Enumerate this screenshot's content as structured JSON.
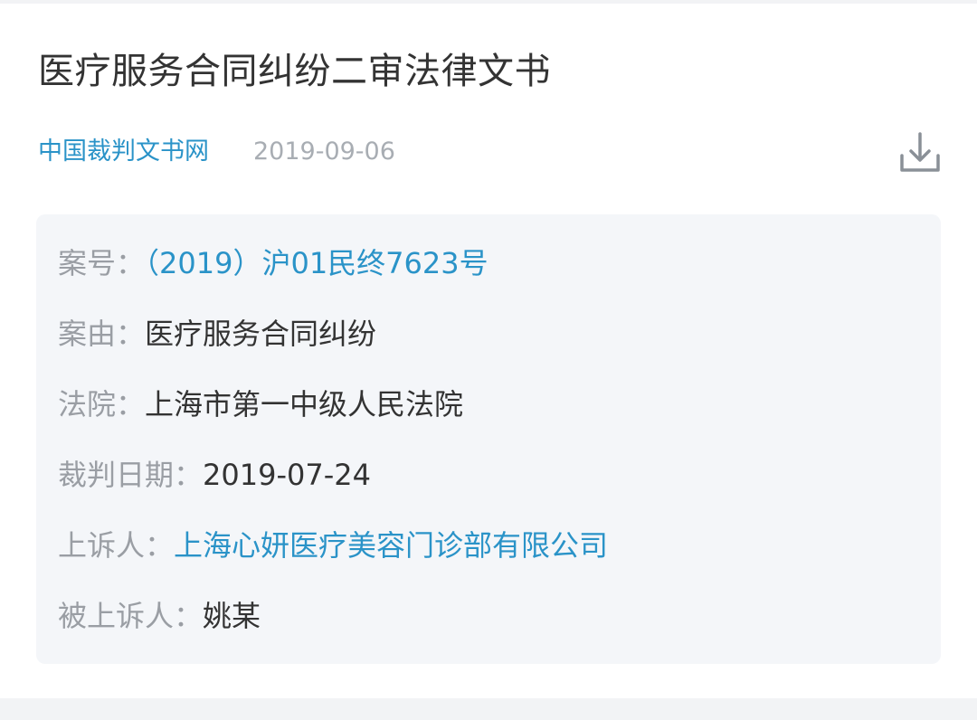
{
  "document": {
    "title": "医疗服务合同纠纷二审法律文书",
    "source": "中国裁判文书网",
    "publish_date": "2019-09-06",
    "download_icon": "download-icon"
  },
  "case_info": {
    "case_number": {
      "label": "案号：",
      "value": "（2019）沪01民终7623号"
    },
    "cause": {
      "label": "案由：",
      "value": "医疗服务合同纠纷"
    },
    "court": {
      "label": "法院：",
      "value": "上海市第一中级人民法院"
    },
    "judgment_date": {
      "label": "裁判日期：",
      "value": "2019-07-24"
    },
    "appellant": {
      "label": "上诉人：",
      "value": "上海心妍医疗美容门诊部有限公司"
    },
    "appellee": {
      "label": "被上诉人：",
      "value": "姚某"
    }
  },
  "colors": {
    "link": "#2a93c8",
    "label": "#9a9ea4",
    "text": "#333333",
    "card_bg": "#f4f6f9"
  }
}
